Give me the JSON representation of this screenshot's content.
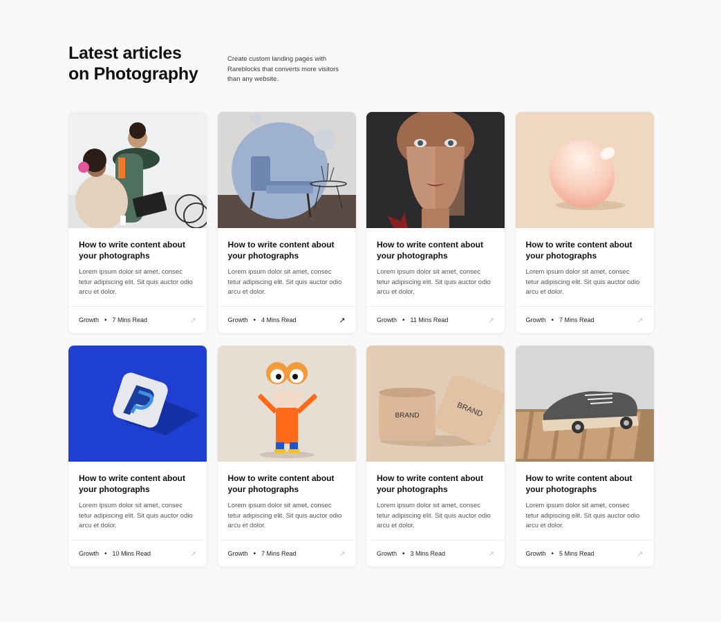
{
  "header": {
    "title_line1": "Latest articles",
    "title_line2": "on Photography",
    "description": "Create custom landing pages with Rareblocks that converts more visitors than any website."
  },
  "cards": [
    {
      "title": "How to write content about your photographs",
      "excerpt": "Lorem ipsum dolor sit amet, consec tetur adipiscing elit. Sit quis auctor odio arcu et dolor.",
      "category": "Growth",
      "read_time": "7 Mins Read",
      "image": "people-with-laptop"
    },
    {
      "title": "How to write content about your photographs",
      "excerpt": "Lorem ipsum dolor sit amet, consec tetur adipiscing elit. Sit quis auctor odio arcu et dolor.",
      "category": "Growth",
      "read_time": "4 Mins Read",
      "image": "blue-armchair"
    },
    {
      "title": "How to write content about your photographs",
      "excerpt": "Lorem ipsum dolor sit amet, consec tetur adipiscing elit. Sit quis auctor odio arcu et dolor.",
      "category": "Growth",
      "read_time": "11 Mins Read",
      "image": "3d-face"
    },
    {
      "title": "How to write content about your photographs",
      "excerpt": "Lorem ipsum dolor sit amet, consec tetur adipiscing elit. Sit quis auctor odio arcu et dolor.",
      "category": "Growth",
      "read_time": "7 Mins Read",
      "image": "pink-egg-vase"
    },
    {
      "title": "How to write content about your photographs",
      "excerpt": "Lorem ipsum dolor sit amet, consec tetur adipiscing elit. Sit quis auctor odio arcu et dolor.",
      "category": "Growth",
      "read_time": "10 Mins Read",
      "image": "paypal-3d-icon"
    },
    {
      "title": "How to write content about your photographs",
      "excerpt": "Lorem ipsum dolor sit amet, consec tetur adipiscing elit. Sit quis auctor odio arcu et dolor.",
      "category": "Growth",
      "read_time": "7 Mins Read",
      "image": "orange-character"
    },
    {
      "title": "How to write content about your photographs",
      "excerpt": "Lorem ipsum dolor sit amet, consec tetur adipiscing elit. Sit quis auctor odio arcu et dolor.",
      "category": "Growth",
      "read_time": "3 Mins Read",
      "image": "brand-jars"
    },
    {
      "title": "How to write content about your photographs",
      "excerpt": "Lorem ipsum dolor sit amet, consec tetur adipiscing elit. Sit quis auctor odio arcu et dolor.",
      "category": "Growth",
      "read_time": "5 Mins Read",
      "image": "sneaker-car"
    }
  ],
  "images": {
    "brand_label": "BRAND"
  },
  "colors": {
    "background": "#f9f9f9",
    "card": "#ffffff",
    "text": "#111111",
    "muted": "#555555",
    "arrow_inactive": "#c8c8c8",
    "arrow_active": "#111111"
  }
}
